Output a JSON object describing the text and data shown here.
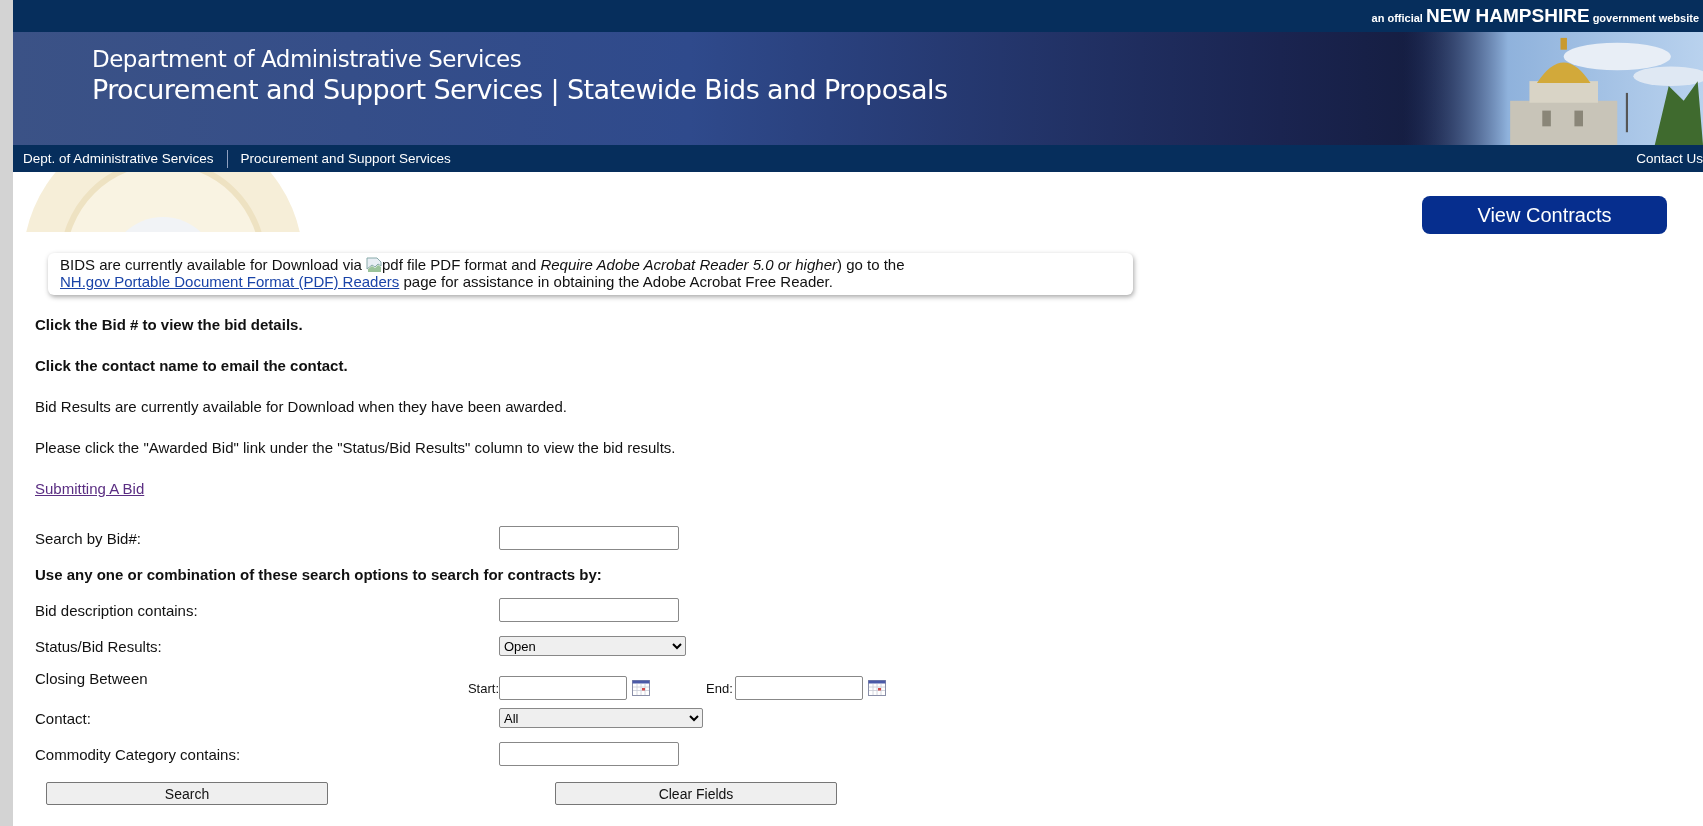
{
  "top_bar": {
    "prefix": "an official",
    "state": "NEW HAMPSHIRE",
    "suffix": "government website"
  },
  "header": {
    "department": "Department of Administrative Services",
    "title": "Procurement and Support Services | Statewide Bids and Proposals"
  },
  "nav": {
    "items": [
      {
        "label": "Dept. of Administrative Services"
      },
      {
        "label": "Procurement and Support Services"
      }
    ],
    "contact": "Contact Us"
  },
  "view_contracts_button": "View Contracts",
  "notice": {
    "before": "BIDS are currently available for Download via",
    "image_alt": "pdf file",
    "middle": "PDF format and *Require Adobe Acrobat Reader 5.0 or higher*) go to the",
    "link": "NH.gov Portable Document Format (PDF) Readers",
    "after": "page for assistance in obtaining the Adobe Acrobat Free Reader."
  },
  "instructions": [
    {
      "text": "Click the Bid # to view the bid details.",
      "bold": true
    },
    {
      "text": "Click the contact name to email the contact.",
      "bold": true
    },
    {
      "text": "Bid Results are currently available for Download when they have been awarded.",
      "bold": false
    },
    {
      "text": "Please click the \"Awarded Bid\" link under the \"Status/Bid Results\" column to view the bid results.",
      "bold": false
    }
  ],
  "submitting_link": "Submitting A Bid",
  "form": {
    "rows": [
      {
        "kind": "text",
        "label": "Search by Bid#:"
      },
      {
        "kind": "heading",
        "label": "Use any one or combination of these search options to search for contracts by:"
      },
      {
        "kind": "text",
        "label": "Bid description contains:"
      },
      {
        "kind": "select",
        "label": "Status/Bid Results:",
        "value": "Open"
      },
      {
        "kind": "daterange",
        "label": "Closing Between",
        "start_label": "Start:",
        "end_label": "End:"
      },
      {
        "kind": "select",
        "label": "Contact:",
        "value": "All",
        "wide": true
      },
      {
        "kind": "text",
        "label": "Commodity Category contains:"
      }
    ],
    "buttons": [
      "Search",
      "Clear Fields"
    ]
  }
}
